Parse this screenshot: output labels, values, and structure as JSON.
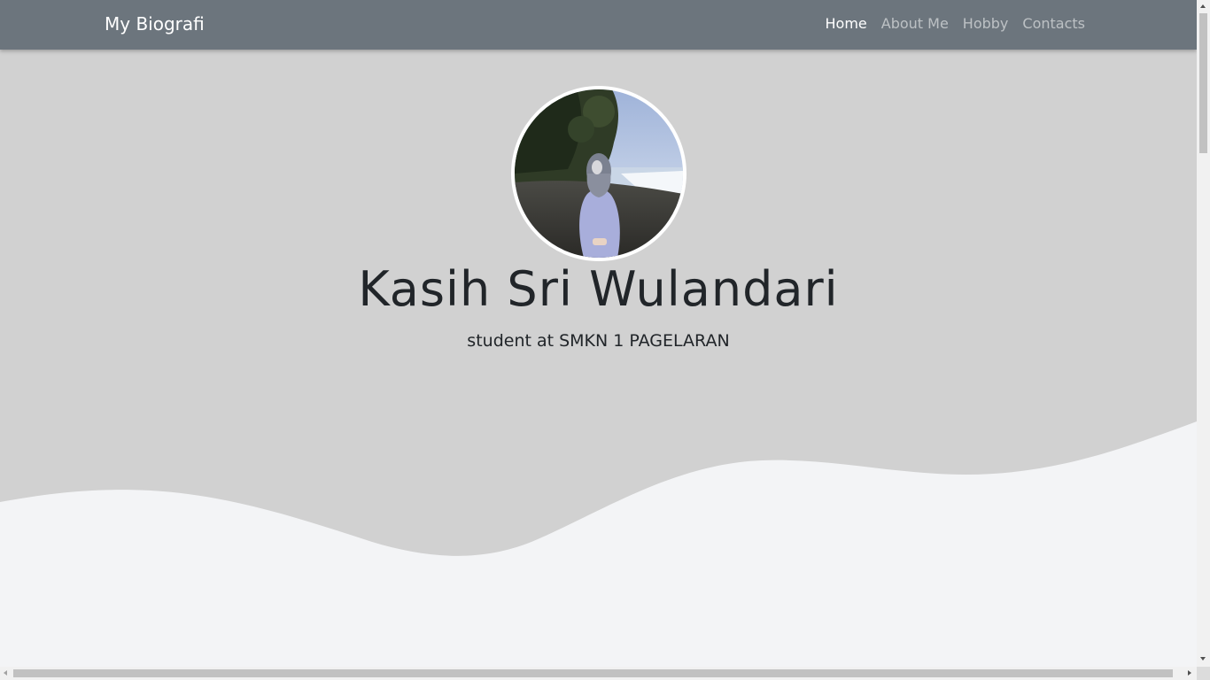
{
  "navbar": {
    "brand": "My Biografi",
    "links": [
      {
        "label": "Home",
        "active": true
      },
      {
        "label": "About Me",
        "active": false
      },
      {
        "label": "Hobby",
        "active": false
      },
      {
        "label": "Contacts",
        "active": false
      }
    ]
  },
  "hero": {
    "name": "Kasih Sri Wulandari",
    "subtitle": "student at SMKN 1 PAGELARAN",
    "photo_icon": "profile-photo"
  },
  "colors": {
    "navbar_bg": "#6c757d",
    "hero_bg": "#d1d1d1",
    "wave_fill": "#f3f4f6",
    "text_dark": "#212529"
  }
}
